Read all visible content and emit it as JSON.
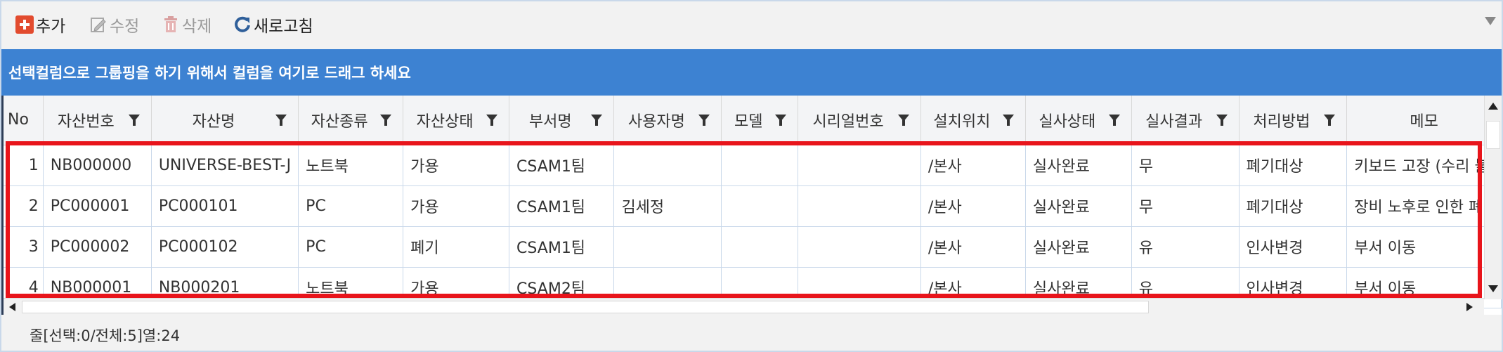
{
  "toolbar": {
    "add_label": "추가",
    "edit_label": "수정",
    "delete_label": "삭제",
    "refresh_label": "새로고침"
  },
  "group_panel": {
    "text": "선택컬럼으로 그룹핑을 하기 위해서 컬럼을 여기로 드래그 하세요"
  },
  "grid": {
    "columns": [
      "No",
      "자산번호",
      "자산명",
      "자산종류",
      "자산상태",
      "부서명",
      "사용자명",
      "모델",
      "시리얼번호",
      "설치위치",
      "실사상태",
      "실사결과",
      "처리방법",
      "메모"
    ],
    "rows": [
      [
        "1",
        "NB000000",
        "UNIVERSE-BEST-J",
        "노트북",
        "가용",
        "CSAM1팀",
        "",
        "",
        "",
        "/본사",
        "실사완료",
        "무",
        "폐기대상",
        "키보드 고장 (수리 불"
      ],
      [
        "2",
        "PC000001",
        "PC000101",
        "PC",
        "가용",
        "CSAM1팀",
        "김세정",
        "",
        "",
        "/본사",
        "실사완료",
        "무",
        "폐기대상",
        "장비 노후로 인한 폐"
      ],
      [
        "3",
        "PC000002",
        "PC000102",
        "PC",
        "폐기",
        "CSAM1팀",
        "",
        "",
        "",
        "/본사",
        "실사완료",
        "유",
        "인사변경",
        "부서 이동"
      ],
      [
        "4",
        "NB000001",
        "NB000201",
        "노트북",
        "가용",
        "CSAM2팀",
        "",
        "",
        "",
        "/본사",
        "실사완료",
        "유",
        "인사변경",
        "부서 이동"
      ]
    ]
  },
  "status": {
    "text": "줄[선택:0/전체:5]열:24"
  },
  "colors": {
    "group_panel_bg": "#3d82d2",
    "highlight_border": "#e8141b",
    "add_icon": "#e24b2e"
  }
}
